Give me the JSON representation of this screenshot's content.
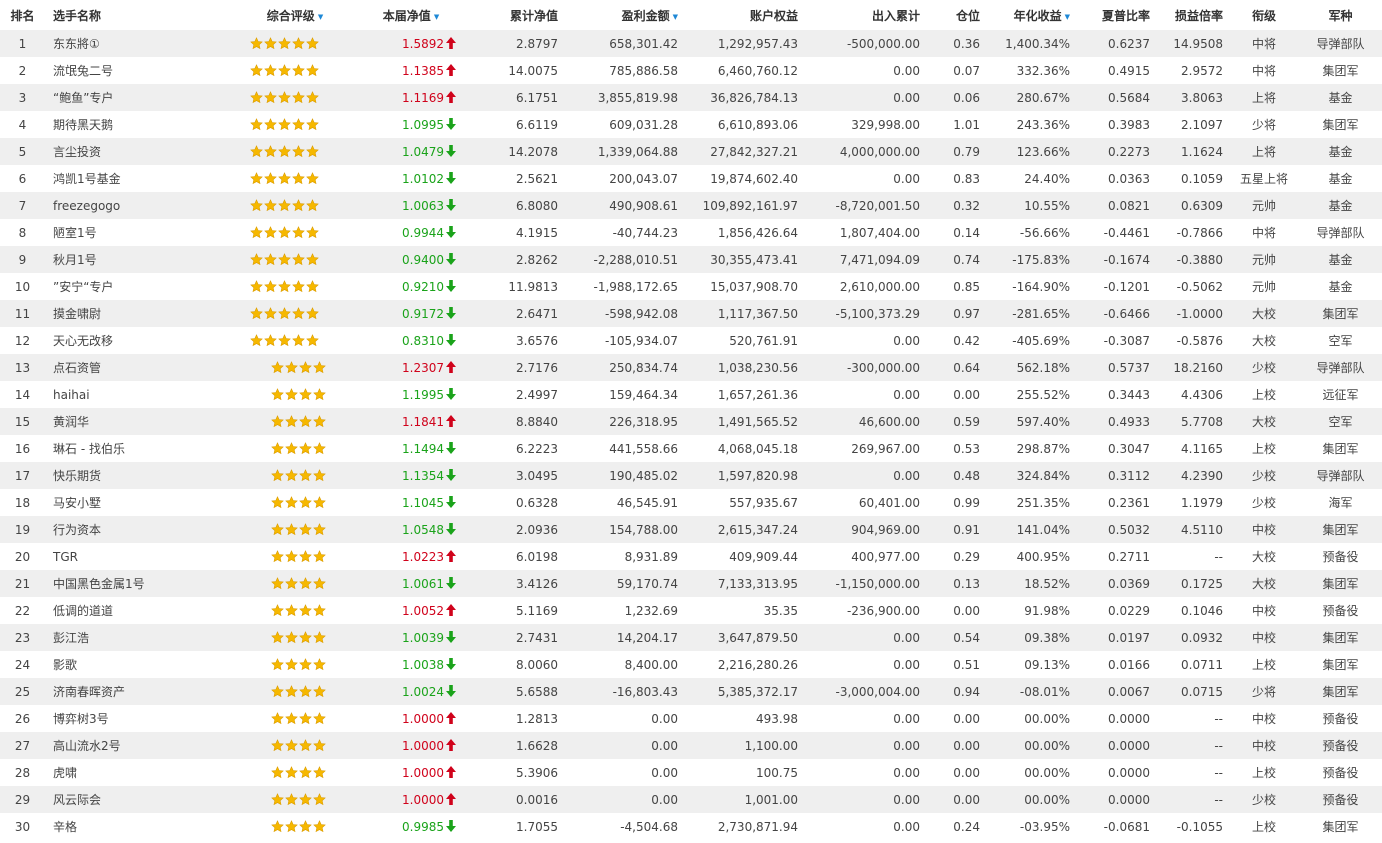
{
  "header": {
    "rank": "排名",
    "name": "选手名称",
    "rating": "综合评级",
    "nav": "本届净值",
    "cum_nav": "累计净值",
    "profit": "盈利金额",
    "equity": "账户权益",
    "flow": "出入累计",
    "position": "仓位",
    "annual": "年化收益",
    "sharpe": "夏普比率",
    "pl_ratio": "损益倍率",
    "title": "衔级",
    "army": "军种",
    "sort_icon": "▼"
  },
  "colors": {
    "up": "#d0021b",
    "down": "#1aa31a",
    "sort": "#1e88d6",
    "star": "#f6b800",
    "stripe": "#efefef"
  },
  "rows": [
    {
      "rank": "1",
      "name": "东东將①",
      "stars": 5,
      "nav": "1.5892",
      "dir": "up",
      "cum": "2.8797",
      "profit": "658,301.42",
      "equity": "1,292,957.43",
      "flow": "-500,000.00",
      "pos": "0.36",
      "annual": "1,400.34%",
      "sharpe": "0.6237",
      "pl": "14.9508",
      "title": "中将",
      "army": "导弹部队"
    },
    {
      "rank": "2",
      "name": "流氓兔二号",
      "stars": 5,
      "nav": "1.1385",
      "dir": "up",
      "cum": "14.0075",
      "profit": "785,886.58",
      "equity": "6,460,760.12",
      "flow": "0.00",
      "pos": "0.07",
      "annual": "332.36%",
      "sharpe": "0.4915",
      "pl": "2.9572",
      "title": "中将",
      "army": "集团军"
    },
    {
      "rank": "3",
      "name": "“鲍鱼”专户",
      "stars": 5,
      "nav": "1.1169",
      "dir": "up",
      "cum": "6.1751",
      "profit": "3,855,819.98",
      "equity": "36,826,784.13",
      "flow": "0.00",
      "pos": "0.06",
      "annual": "280.67%",
      "sharpe": "0.5684",
      "pl": "3.8063",
      "title": "上将",
      "army": "基金"
    },
    {
      "rank": "4",
      "name": "期待黑天鹅",
      "stars": 5,
      "nav": "1.0995",
      "dir": "down",
      "cum": "6.6119",
      "profit": "609,031.28",
      "equity": "6,610,893.06",
      "flow": "329,998.00",
      "pos": "1.01",
      "annual": "243.36%",
      "sharpe": "0.3983",
      "pl": "2.1097",
      "title": "少将",
      "army": "集团军"
    },
    {
      "rank": "5",
      "name": "言尘投资",
      "stars": 5,
      "nav": "1.0479",
      "dir": "down",
      "cum": "14.2078",
      "profit": "1,339,064.88",
      "equity": "27,842,327.21",
      "flow": "4,000,000.00",
      "pos": "0.79",
      "annual": "123.66%",
      "sharpe": "0.2273",
      "pl": "1.1624",
      "title": "上将",
      "army": "基金"
    },
    {
      "rank": "6",
      "name": "鸿凯1号基金",
      "stars": 5,
      "nav": "1.0102",
      "dir": "down",
      "cum": "2.5621",
      "profit": "200,043.07",
      "equity": "19,874,602.40",
      "flow": "0.00",
      "pos": "0.83",
      "annual": "24.40%",
      "sharpe": "0.0363",
      "pl": "0.1059",
      "title": "五星上将",
      "army": "基金"
    },
    {
      "rank": "7",
      "name": "freezegogo",
      "stars": 5,
      "nav": "1.0063",
      "dir": "down",
      "cum": "6.8080",
      "profit": "490,908.61",
      "equity": "109,892,161.97",
      "flow": "-8,720,001.50",
      "pos": "0.32",
      "annual": "10.55%",
      "sharpe": "0.0821",
      "pl": "0.6309",
      "title": "元帅",
      "army": "基金"
    },
    {
      "rank": "8",
      "name": "陋室1号",
      "stars": 5,
      "nav": "0.9944",
      "dir": "down",
      "cum": "4.1915",
      "profit": "-40,744.23",
      "equity": "1,856,426.64",
      "flow": "1,807,404.00",
      "pos": "0.14",
      "annual": "-56.66%",
      "sharpe": "-0.4461",
      "pl": "-0.7866",
      "title": "中将",
      "army": "导弹部队"
    },
    {
      "rank": "9",
      "name": "秋月1号",
      "stars": 5,
      "nav": "0.9400",
      "dir": "down",
      "cum": "2.8262",
      "profit": "-2,288,010.51",
      "equity": "30,355,473.41",
      "flow": "7,471,094.09",
      "pos": "0.74",
      "annual": "-175.83%",
      "sharpe": "-0.1674",
      "pl": "-0.3880",
      "title": "元帅",
      "army": "基金"
    },
    {
      "rank": "10",
      "name": "”安宁“专户",
      "stars": 5,
      "nav": "0.9210",
      "dir": "down",
      "cum": "11.9813",
      "profit": "-1,988,172.65",
      "equity": "15,037,908.70",
      "flow": "2,610,000.00",
      "pos": "0.85",
      "annual": "-164.90%",
      "sharpe": "-0.1201",
      "pl": "-0.5062",
      "title": "元帅",
      "army": "基金"
    },
    {
      "rank": "11",
      "name": "摸金啸尉",
      "stars": 5,
      "nav": "0.9172",
      "dir": "down",
      "cum": "2.6471",
      "profit": "-598,942.08",
      "equity": "1,117,367.50",
      "flow": "-5,100,373.29",
      "pos": "0.97",
      "annual": "-281.65%",
      "sharpe": "-0.6466",
      "pl": "-1.0000",
      "title": "大校",
      "army": "集团军"
    },
    {
      "rank": "12",
      "name": "天心无改移",
      "stars": 5,
      "nav": "0.8310",
      "dir": "down",
      "cum": "3.6576",
      "profit": "-105,934.07",
      "equity": "520,761.91",
      "flow": "0.00",
      "pos": "0.42",
      "annual": "-405.69%",
      "sharpe": "-0.3087",
      "pl": "-0.5876",
      "title": "大校",
      "army": "空军"
    },
    {
      "rank": "13",
      "name": "点石资管",
      "stars": 4,
      "nav": "1.2307",
      "dir": "up",
      "cum": "2.7176",
      "profit": "250,834.74",
      "equity": "1,038,230.56",
      "flow": "-300,000.00",
      "pos": "0.64",
      "annual": "562.18%",
      "sharpe": "0.5737",
      "pl": "18.2160",
      "title": "少校",
      "army": "导弹部队"
    },
    {
      "rank": "14",
      "name": "haihai",
      "stars": 4,
      "nav": "1.1995",
      "dir": "down",
      "cum": "2.4997",
      "profit": "159,464.34",
      "equity": "1,657,261.36",
      "flow": "0.00",
      "pos": "0.00",
      "annual": "255.52%",
      "sharpe": "0.3443",
      "pl": "4.4306",
      "title": "上校",
      "army": "远征军"
    },
    {
      "rank": "15",
      "name": "黄润华",
      "stars": 4,
      "nav": "1.1841",
      "dir": "up",
      "cum": "8.8840",
      "profit": "226,318.95",
      "equity": "1,491,565.52",
      "flow": "46,600.00",
      "pos": "0.59",
      "annual": "597.40%",
      "sharpe": "0.4933",
      "pl": "5.7708",
      "title": "大校",
      "army": "空军"
    },
    {
      "rank": "16",
      "name": "琳石 - 找伯乐",
      "stars": 4,
      "nav": "1.1494",
      "dir": "down",
      "cum": "6.2223",
      "profit": "441,558.66",
      "equity": "4,068,045.18",
      "flow": "269,967.00",
      "pos": "0.53",
      "annual": "298.87%",
      "sharpe": "0.3047",
      "pl": "4.1165",
      "title": "上校",
      "army": "集团军"
    },
    {
      "rank": "17",
      "name": "快乐期货",
      "stars": 4,
      "nav": "1.1354",
      "dir": "down",
      "cum": "3.0495",
      "profit": "190,485.02",
      "equity": "1,597,820.98",
      "flow": "0.00",
      "pos": "0.48",
      "annual": "324.84%",
      "sharpe": "0.3112",
      "pl": "4.2390",
      "title": "少校",
      "army": "导弹部队"
    },
    {
      "rank": "18",
      "name": "马安小墅",
      "stars": 4,
      "nav": "1.1045",
      "dir": "down",
      "cum": "0.6328",
      "profit": "46,545.91",
      "equity": "557,935.67",
      "flow": "60,401.00",
      "pos": "0.99",
      "annual": "251.35%",
      "sharpe": "0.2361",
      "pl": "1.1979",
      "title": "少校",
      "army": "海军"
    },
    {
      "rank": "19",
      "name": "行为资本",
      "stars": 4,
      "nav": "1.0548",
      "dir": "down",
      "cum": "2.0936",
      "profit": "154,788.00",
      "equity": "2,615,347.24",
      "flow": "904,969.00",
      "pos": "0.91",
      "annual": "141.04%",
      "sharpe": "0.5032",
      "pl": "4.5110",
      "title": "中校",
      "army": "集团军"
    },
    {
      "rank": "20",
      "name": "TGR",
      "stars": 4,
      "nav": "1.0223",
      "dir": "up",
      "cum": "6.0198",
      "profit": "8,931.89",
      "equity": "409,909.44",
      "flow": "400,977.00",
      "pos": "0.29",
      "annual": "400.95%",
      "sharpe": "0.2711",
      "pl": "--",
      "title": "大校",
      "army": "预备役"
    },
    {
      "rank": "21",
      "name": "中国黑色金属1号",
      "stars": 4,
      "nav": "1.0061",
      "dir": "down",
      "cum": "3.4126",
      "profit": "59,170.74",
      "equity": "7,133,313.95",
      "flow": "-1,150,000.00",
      "pos": "0.13",
      "annual": "18.52%",
      "sharpe": "0.0369",
      "pl": "0.1725",
      "title": "大校",
      "army": "集团军"
    },
    {
      "rank": "22",
      "name": "低调的道道",
      "stars": 4,
      "nav": "1.0052",
      "dir": "up",
      "cum": "5.1169",
      "profit": "1,232.69",
      "equity": "35.35",
      "flow": "-236,900.00",
      "pos": "0.00",
      "annual": "91.98%",
      "sharpe": "0.0229",
      "pl": "0.1046",
      "title": "中校",
      "army": "预备役"
    },
    {
      "rank": "23",
      "name": "彭江浩",
      "stars": 4,
      "nav": "1.0039",
      "dir": "down",
      "cum": "2.7431",
      "profit": "14,204.17",
      "equity": "3,647,879.50",
      "flow": "0.00",
      "pos": "0.54",
      "annual": "09.38%",
      "sharpe": "0.0197",
      "pl": "0.0932",
      "title": "中校",
      "army": "集团军"
    },
    {
      "rank": "24",
      "name": "影歌",
      "stars": 4,
      "nav": "1.0038",
      "dir": "down",
      "cum": "8.0060",
      "profit": "8,400.00",
      "equity": "2,216,280.26",
      "flow": "0.00",
      "pos": "0.51",
      "annual": "09.13%",
      "sharpe": "0.0166",
      "pl": "0.0711",
      "title": "上校",
      "army": "集团军"
    },
    {
      "rank": "25",
      "name": "济南春晖资产",
      "stars": 4,
      "nav": "1.0024",
      "dir": "down",
      "cum": "5.6588",
      "profit": "-16,803.43",
      "equity": "5,385,372.17",
      "flow": "-3,000,004.00",
      "pos": "0.94",
      "annual": "-08.01%",
      "sharpe": "0.0067",
      "pl": "0.0715",
      "title": "少将",
      "army": "集团军"
    },
    {
      "rank": "26",
      "name": "博弈树3号",
      "stars": 4,
      "nav": "1.0000",
      "dir": "up",
      "cum": "1.2813",
      "profit": "0.00",
      "equity": "493.98",
      "flow": "0.00",
      "pos": "0.00",
      "annual": "00.00%",
      "sharpe": "0.0000",
      "pl": "--",
      "title": "中校",
      "army": "预备役"
    },
    {
      "rank": "27",
      "name": "高山流水2号",
      "stars": 4,
      "nav": "1.0000",
      "dir": "up",
      "cum": "1.6628",
      "profit": "0.00",
      "equity": "1,100.00",
      "flow": "0.00",
      "pos": "0.00",
      "annual": "00.00%",
      "sharpe": "0.0000",
      "pl": "--",
      "title": "中校",
      "army": "预备役"
    },
    {
      "rank": "28",
      "name": "虎啸",
      "stars": 4,
      "nav": "1.0000",
      "dir": "up",
      "cum": "5.3906",
      "profit": "0.00",
      "equity": "100.75",
      "flow": "0.00",
      "pos": "0.00",
      "annual": "00.00%",
      "sharpe": "0.0000",
      "pl": "--",
      "title": "上校",
      "army": "预备役"
    },
    {
      "rank": "29",
      "name": "风云际会",
      "stars": 4,
      "nav": "1.0000",
      "dir": "up",
      "cum": "0.0016",
      "profit": "0.00",
      "equity": "1,001.00",
      "flow": "0.00",
      "pos": "0.00",
      "annual": "00.00%",
      "sharpe": "0.0000",
      "pl": "--",
      "title": "少校",
      "army": "预备役"
    },
    {
      "rank": "30",
      "name": "辛格",
      "stars": 4,
      "nav": "0.9985",
      "dir": "down",
      "cum": "1.7055",
      "profit": "-4,504.68",
      "equity": "2,730,871.94",
      "flow": "0.00",
      "pos": "0.24",
      "annual": "-03.95%",
      "sharpe": "-0.0681",
      "pl": "-0.1055",
      "title": "上校",
      "army": "集团军"
    }
  ]
}
